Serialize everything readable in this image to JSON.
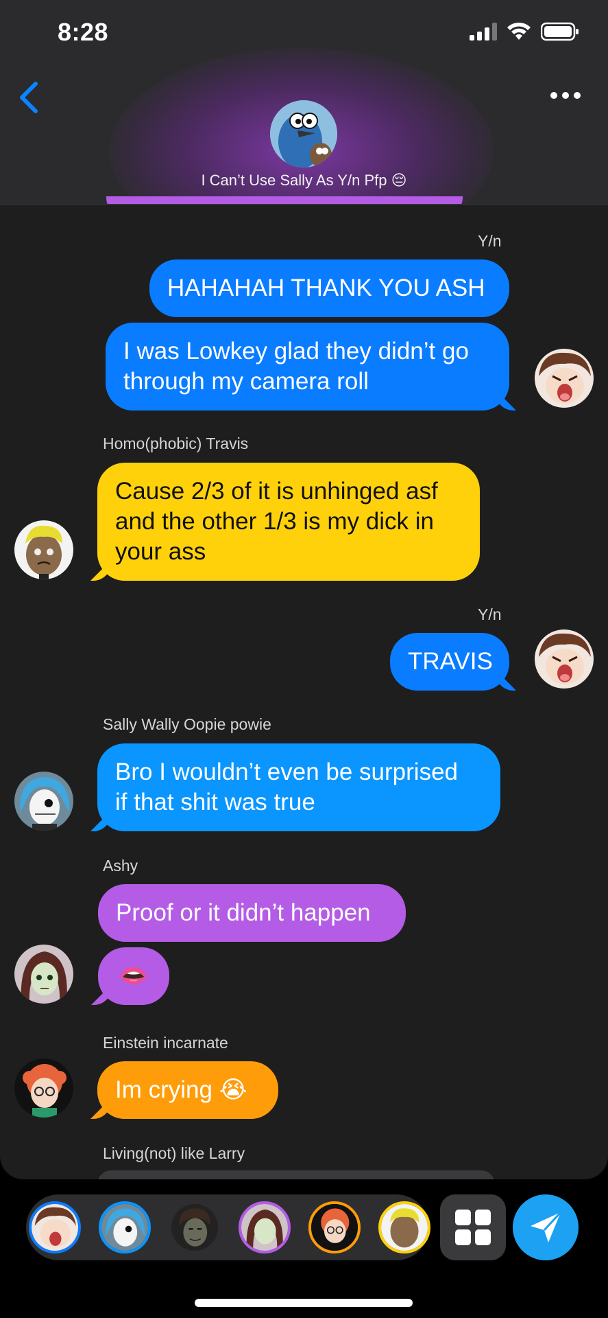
{
  "status_bar": {
    "time": "8:28"
  },
  "header": {
    "group_name": "I Can’t Use Sally As Y/n Pfp 😔"
  },
  "messages": [
    {
      "sender": "Y/n",
      "texts": [
        "HAHAHAH THANK YOU ASH",
        "I was Lowkey glad they didn’t go",
        "through my camera roll"
      ]
    },
    {
      "sender": "Homo(phobic) Travis",
      "texts": [
        "Cause 2/3 of it is unhinged asf",
        "and the other 1/3 is my dick in",
        "your ass"
      ]
    },
    {
      "sender": "Y/n",
      "texts": [
        "TRAVIS"
      ]
    },
    {
      "sender": "Sally Wally Oopie powie",
      "texts": [
        "Bro I wouldn’t even be surprised",
        "if that shit was true"
      ]
    },
    {
      "sender": "Ashy",
      "texts": [
        "Proof or it didn’t happen",
        "👄"
      ]
    },
    {
      "sender": "Einstein incarnate",
      "texts": [
        "Im crying 😭"
      ]
    },
    {
      "sender": "Living(not) like Larry",
      "texts": []
    }
  ],
  "colors": {
    "yn": "#0a7cff",
    "travis": "#ffd10a",
    "sally": "#0a95ff",
    "ashy": "#b45ce6",
    "einstein": "#ff9c0a"
  },
  "icons": [
    "back-chevron-icon",
    "more-dots-icon",
    "apps-grid-icon",
    "send-paper-plane-icon",
    "signal-icon",
    "wifi-icon",
    "battery-icon"
  ]
}
